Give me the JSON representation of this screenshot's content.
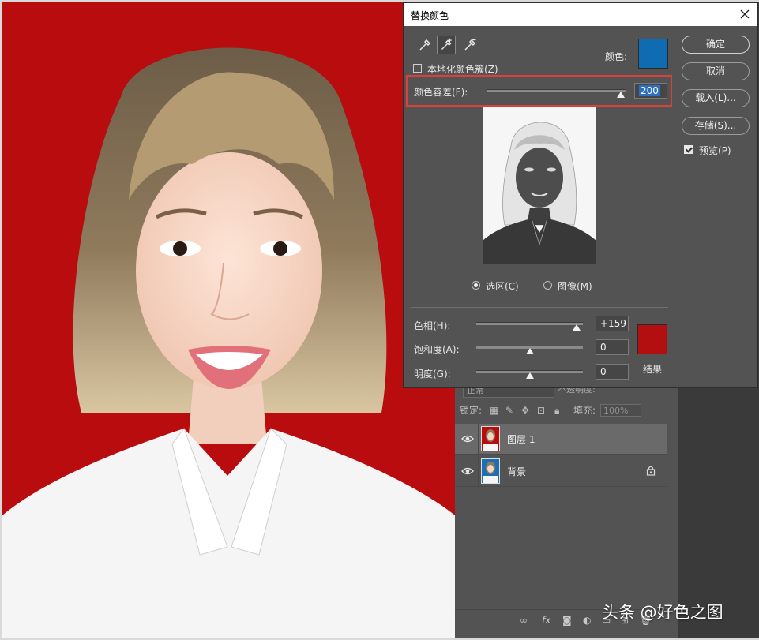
{
  "dialog": {
    "title": "替换颜色",
    "localized_color_clusters_label": "本地化颜色簇(Z)",
    "localized_color_clusters_checked": false,
    "color_label": "颜色:",
    "selected_color": "#0f6cb3",
    "fuzziness_label": "颜色容差(F):",
    "fuzziness_value": "200",
    "fuzziness_level": 200,
    "fuzziness_max": 200,
    "view_options": [
      {
        "label": "选区(C)",
        "selected": true
      },
      {
        "label": "图像(M)",
        "selected": false
      }
    ],
    "hue_label": "色相(H):",
    "hue_value": "+159",
    "saturation_label": "饱和度(A):",
    "saturation_value": "0",
    "lightness_label": "明度(G):",
    "lightness_value": "0",
    "result_label": "结果",
    "result_color": "#b30f11",
    "buttons": {
      "ok": "确定",
      "cancel": "取消",
      "load": "载入(L)...",
      "save": "存储(S)..."
    },
    "preview_label": "预览(P)",
    "preview_checked": true,
    "highlight_color": "#d9413b"
  },
  "layers_panel": {
    "blend_mode": "正常",
    "opacity_label": "不透明度:",
    "lock_label": "锁定:",
    "fill_label": "填充:",
    "fill_value": "100%",
    "layers": [
      {
        "name": "图层 1",
        "active": true,
        "locked": false
      },
      {
        "name": "背景",
        "active": false,
        "locked": true
      }
    ],
    "footer_icons": [
      "link-icon",
      "fx-icon",
      "mask-icon",
      "adjustment-icon",
      "group-icon",
      "new-layer-icon",
      "trash-icon"
    ]
  },
  "photo": {
    "background_color": "#b80c0f"
  },
  "watermark": "头条 @好色之图"
}
